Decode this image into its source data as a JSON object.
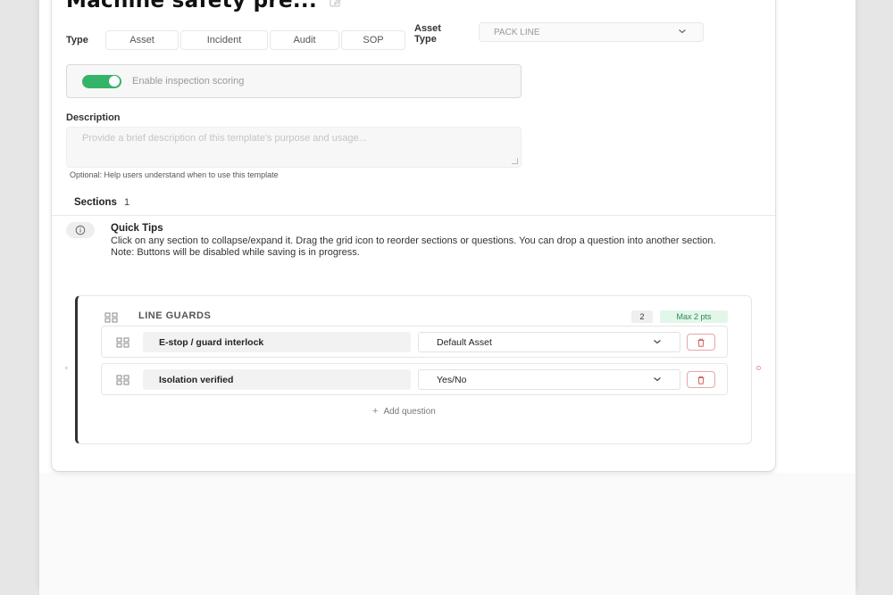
{
  "header": {
    "title": "Machine safety pre..."
  },
  "type_selector": {
    "label": "Type",
    "options": [
      "Asset",
      "Incident",
      "Audit",
      "SOP"
    ]
  },
  "asset_type": {
    "label_line1": "Asset",
    "label_line2": "Type",
    "value": "PACK LINE"
  },
  "scoring": {
    "enabled": true,
    "label": "Enable inspection scoring",
    "accent_color": "#34b468"
  },
  "description": {
    "label": "Description",
    "placeholder": "Provide a brief description of this template's purpose and usage...",
    "helper": "Optional: Help users understand when to use this template"
  },
  "sections_header": {
    "label": "Sections",
    "count": "1"
  },
  "quick_tips": {
    "title": "Quick Tips",
    "line1": "Click on any section to collapse/expand it. Drag the grid icon to reorder sections or questions. You can drop a question into another section.",
    "line2": "Note: Buttons will be disabled while saving is in progress."
  },
  "section": {
    "name": "LINE GUARDS",
    "question_count": "2",
    "max_points": "Max 2 pts",
    "questions": [
      {
        "name": "E-stop / guard interlock",
        "response_type": "Default Asset"
      },
      {
        "name": "Isolation verified",
        "response_type": "Yes/No"
      }
    ],
    "add_question_label": "Add question"
  }
}
